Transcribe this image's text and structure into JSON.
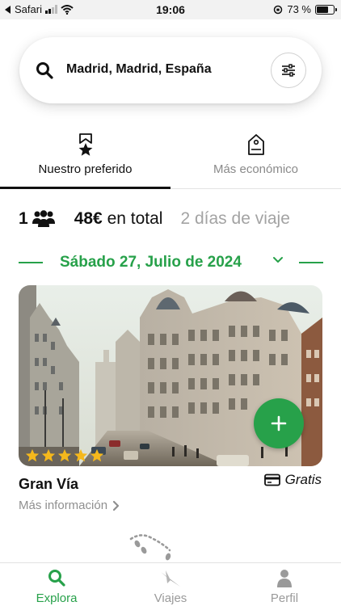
{
  "status_bar": {
    "back_app": "Safari",
    "time": "19:06",
    "battery": "73 %"
  },
  "search": {
    "value": "Madrid, Madrid, España",
    "icon": "search-icon",
    "filter_icon": "sliders-icon"
  },
  "tabs": [
    {
      "label": "Nuestro preferido",
      "icon": "star-ribbon-icon",
      "active": true
    },
    {
      "label": "Más económico",
      "icon": "price-tag-icon",
      "active": false
    }
  ],
  "summary": {
    "people_count": "1",
    "price_amount": "48€",
    "price_suffix": " en total",
    "duration": "2 días de viaje"
  },
  "date": {
    "label": "Sábado 27, Julio de 2024"
  },
  "place": {
    "name": "Gran Vía",
    "price_label": "Gratis",
    "more_info": "Más información",
    "rating": 5
  },
  "bottom_nav": [
    {
      "label": "Explora",
      "icon": "search-icon",
      "active": true
    },
    {
      "label": "Viajes",
      "icon": "paper-plane-icon",
      "active": false
    },
    {
      "label": "Perfil",
      "icon": "person-icon",
      "active": false
    }
  ],
  "colors": {
    "accent": "#27a14a",
    "star": "#f5b81c",
    "muted": "#8f8f8f"
  }
}
